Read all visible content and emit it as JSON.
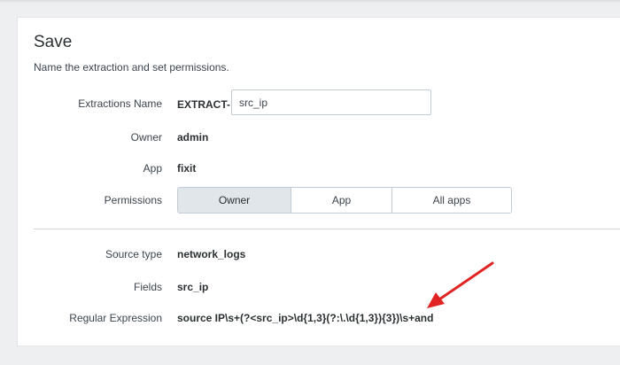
{
  "page": {
    "title": "Save",
    "subtitle": "Name the extraction and set permissions."
  },
  "form": {
    "name_label": "Extractions Name",
    "name_prefix": "EXTRACT-",
    "name_value": "src_ip",
    "owner_label": "Owner",
    "owner_value": "admin",
    "app_label": "App",
    "app_value": "fixit",
    "permissions_label": "Permissions",
    "permissions_options": [
      "Owner",
      "App",
      "All apps"
    ],
    "permissions_selected": "Owner"
  },
  "details": {
    "source_type_label": "Source type",
    "source_type_value": "network_logs",
    "fields_label": "Fields",
    "fields_value": "src_ip",
    "regex_label": "Regular Expression",
    "regex_value": "source IP\\s+(?<src_ip>\\d{1,3}(?:\\.\\d{1,3}){3})\\s+and"
  },
  "annotation": {
    "arrow_color": "#e02424",
    "icon": "red-arrow-annotation"
  }
}
